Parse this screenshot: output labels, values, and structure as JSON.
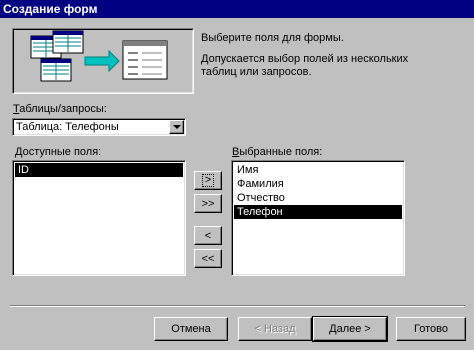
{
  "window": {
    "title": "Создание форм"
  },
  "instructions": {
    "primary": "Выберите поля для формы.",
    "secondary": "Допускается выбор полей из нескольких таблиц или запросов."
  },
  "tables_label": "Таблицы/запросы:",
  "tables_label_hotkey": "Т",
  "tables_label_rest": "аблицы/запросы:",
  "tables_select": {
    "value": "Таблица: Телефоны"
  },
  "available": {
    "label": "Доступные поля:",
    "label_hotkey": "Д",
    "label_rest": "оступные поля:",
    "items": [
      "ID"
    ]
  },
  "selected": {
    "label": "Выбранные поля:",
    "label_hotkey": "В",
    "label_rest": "ыбранные поля:",
    "items": [
      "Имя",
      "Фамилия",
      "Отчество",
      "Телефон"
    ]
  },
  "move_buttons": {
    "add_one": ">",
    "add_all": ">>",
    "remove_one": "<",
    "remove_all": "<<"
  },
  "footer": {
    "cancel": "Отмена",
    "back": "< Назад",
    "next": "Далее >",
    "finish": "Готово"
  },
  "colors": {
    "titlebar": "#000080",
    "face": "#c0c0c0",
    "highlight": "#000000",
    "teal": "#008080"
  }
}
